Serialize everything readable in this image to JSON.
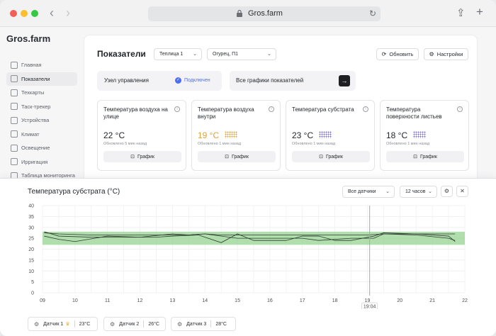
{
  "browser": {
    "url": "Gros.farm",
    "back_icon": "chevron-left-icon",
    "forward_icon": "chevron-right-icon"
  },
  "app": {
    "logo": "Gros.farm"
  },
  "sidebar": {
    "items": [
      {
        "label": "Главная"
      },
      {
        "label": "Показатели",
        "active": true
      },
      {
        "label": "Техкарты"
      },
      {
        "label": "Таск-трекер"
      },
      {
        "label": "Устройства"
      },
      {
        "label": "Климат"
      },
      {
        "label": "Освещение"
      },
      {
        "label": "Ирригация"
      },
      {
        "label": "Таблица мониторинга"
      }
    ]
  },
  "header": {
    "title": "Показатели",
    "greenhouse_select": "Теплица 1",
    "crop_select": "Огурец, П1",
    "refresh_label": "Обновить",
    "settings_label": "Настройки"
  },
  "node": {
    "label": "Узел управления",
    "status": "Подключен"
  },
  "all_graphs": {
    "label": "Все графики показателей"
  },
  "cards": [
    {
      "title": "Температура воздуха на улице",
      "value": "22 °C",
      "updated": "Обновлено 5 мин назад",
      "button": "График",
      "style": "normal",
      "dots": ""
    },
    {
      "title": "Температура воздуха внутри",
      "value": "19 °C",
      "updated": "Обновлено 1 мин назад",
      "button": "График",
      "style": "warn",
      "dots": "orange"
    },
    {
      "title": "Температура субстрата",
      "value": "23 °C",
      "updated": "Обновлено 1 мин назад",
      "button": "График",
      "style": "normal",
      "dots": "purple"
    },
    {
      "title": "Температура поверхности листьев",
      "value": "18 °C",
      "updated": "Обновлено 1 мин назад",
      "button": "График",
      "style": "normal",
      "dots": "purple"
    }
  ],
  "panel": {
    "title": "Температура субстрата (°C)",
    "sensor_select": "Все датчики",
    "period_select": "12 часов",
    "cursor_label": "19:04"
  },
  "legend": [
    {
      "name": "Датчик 1",
      "value": "23°C",
      "crown": true
    },
    {
      "name": "Датчик 2",
      "value": "26°C",
      "crown": false
    },
    {
      "name": "Датчик 3",
      "value": "28°C",
      "crown": false
    }
  ],
  "colors": {
    "accent": "#4b6ef5",
    "band": "#8fd08a",
    "warn": "#e0a13a"
  },
  "chart_data": {
    "type": "line",
    "x_ticks": [
      "09",
      "10",
      "11",
      "12",
      "13",
      "14",
      "15",
      "16",
      "17",
      "18",
      "19",
      "20",
      "21",
      "22"
    ],
    "ylim": [
      0,
      40
    ],
    "y_ticks": [
      0,
      5,
      10,
      15,
      20,
      25,
      30,
      35,
      40
    ],
    "band": [
      22,
      28
    ],
    "grid": true,
    "cursor_x": 19.07,
    "series": [
      {
        "x": [
          9.05,
          9.5,
          10.5,
          11.5,
          12.5,
          13.5,
          14,
          14.5,
          15.5,
          16.5,
          17.5,
          18.5,
          19,
          19.5,
          20.5,
          21.5,
          21.7
        ],
        "values": [
          27.5,
          27,
          26.5,
          26.5,
          26.5,
          26.5,
          27,
          26.5,
          26.5,
          26.5,
          26.5,
          26.5,
          26.5,
          27,
          27,
          27,
          27
        ]
      },
      {
        "x": [
          9.05,
          9.5,
          10.5,
          11.5,
          12.5,
          13,
          13.8,
          14.5,
          15,
          15.5,
          16.5,
          17,
          17.5,
          18,
          18.5,
          19.2,
          19.5,
          20.5,
          21.5,
          21.7
        ],
        "values": [
          28,
          26,
          25.5,
          25.5,
          25.5,
          26,
          26.5,
          23,
          27,
          24,
          24,
          26,
          26,
          24,
          24,
          26,
          27.5,
          27,
          26,
          23.5
        ]
      },
      {
        "x": [
          9.05,
          9.5,
          10,
          11,
          12,
          13,
          13.5,
          14,
          15,
          15.5,
          16,
          17,
          17.5,
          18.5,
          19.2,
          19.5,
          20.5,
          21.5,
          21.7
        ],
        "values": [
          26,
          24.5,
          23.5,
          26,
          25.5,
          27,
          26.5,
          27,
          25,
          25,
          25,
          25,
          24,
          25,
          25,
          27,
          26.5,
          25,
          24
        ]
      }
    ]
  }
}
